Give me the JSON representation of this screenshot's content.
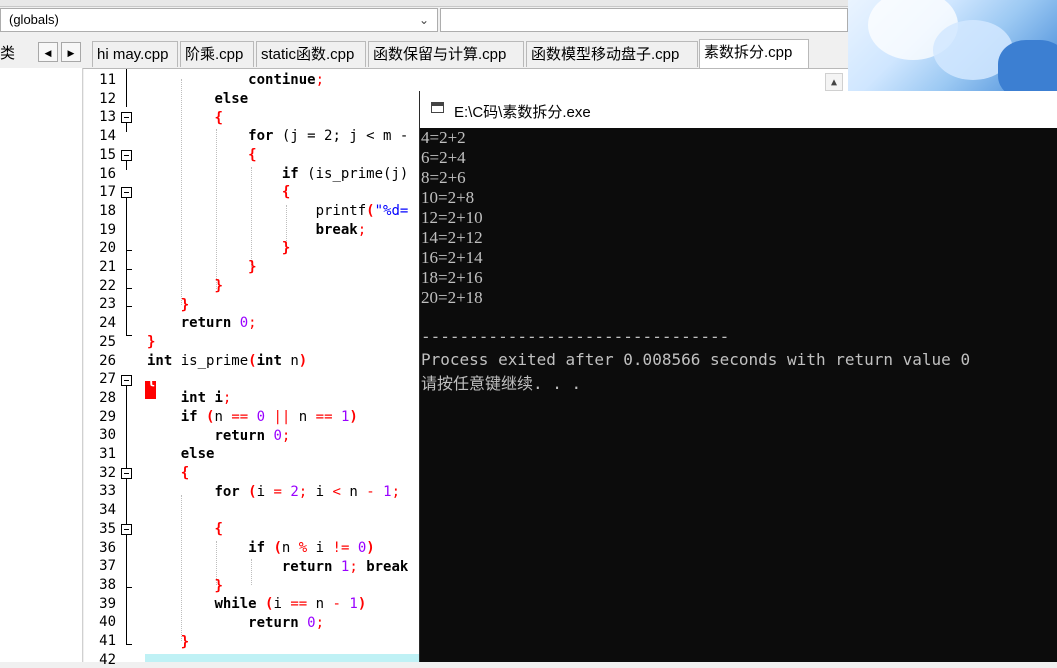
{
  "ide": {
    "globals_selector": "(globals)",
    "left_tab_label": "类",
    "tabs": [
      {
        "label": "hi may.cpp"
      },
      {
        "label": "阶乘.cpp"
      },
      {
        "label": "static函数.cpp"
      },
      {
        "label": "函数保留与计算.cpp"
      },
      {
        "label": "函数模型移动盘子.cpp"
      },
      {
        "label": "素数拆分.cpp",
        "active": true
      }
    ],
    "line_numbers": [
      "11",
      "12",
      "13",
      "14",
      "15",
      "16",
      "17",
      "18",
      "19",
      "20",
      "21",
      "22",
      "23",
      "24",
      "25",
      "26",
      "27",
      "28",
      "29",
      "30",
      "31",
      "32",
      "33",
      "34",
      "35",
      "36",
      "37",
      "38",
      "39",
      "40",
      "41",
      "42"
    ],
    "code": {
      "l11_continue": "continue",
      "l12_else": "else",
      "l14_for": "for",
      "l14_rest": "(j = 2; j < m -",
      "l16_if": "if",
      "l16_call": "(is_prime(j)",
      "l18_printf": "printf",
      "l18_str": "\"%d=",
      "l19_break": "break",
      "l24_return": "return",
      "l24_val": "0",
      "l26_int": "int",
      "l26_name": "is_prime",
      "l26_param_type": "int",
      "l26_param": "n",
      "l28_int": "int",
      "l28_var": "i",
      "l29_if": "if",
      "l29_cond_a": "n",
      "l29_eq": "==",
      "l29_zero": "0",
      "l29_or": "||",
      "l29_cond_b": "n",
      "l29_one": "1",
      "l30_return": "return",
      "l30_val": "0",
      "l31_else": "else",
      "l33_for": "for",
      "l33_i": "i",
      "l33_two": "2",
      "l33_i2": "i",
      "l33_n": "n",
      "l33_one": "1",
      "l36_if": "if",
      "l36_n": "n",
      "l36_i": "i",
      "l36_zero": "0",
      "l37_return": "return",
      "l37_one": "1",
      "l37_break": "break",
      "l39_while": "while",
      "l39_i": "i",
      "l39_n": "n",
      "l39_one": "1",
      "l40_return": "return",
      "l40_val": "0"
    }
  },
  "console": {
    "title": "E:\\C码\\素数拆分.exe",
    "output": [
      "4=2+2",
      "6=2+4",
      "8=2+6",
      "10=2+8",
      "12=2+10",
      "14=2+12",
      "16=2+14",
      "18=2+16",
      "20=2+18"
    ],
    "separator": "--------------------------------",
    "exit_message": "Process exited after 0.008566 seconds with return value 0",
    "prompt": "请按任意键继续. . ."
  }
}
